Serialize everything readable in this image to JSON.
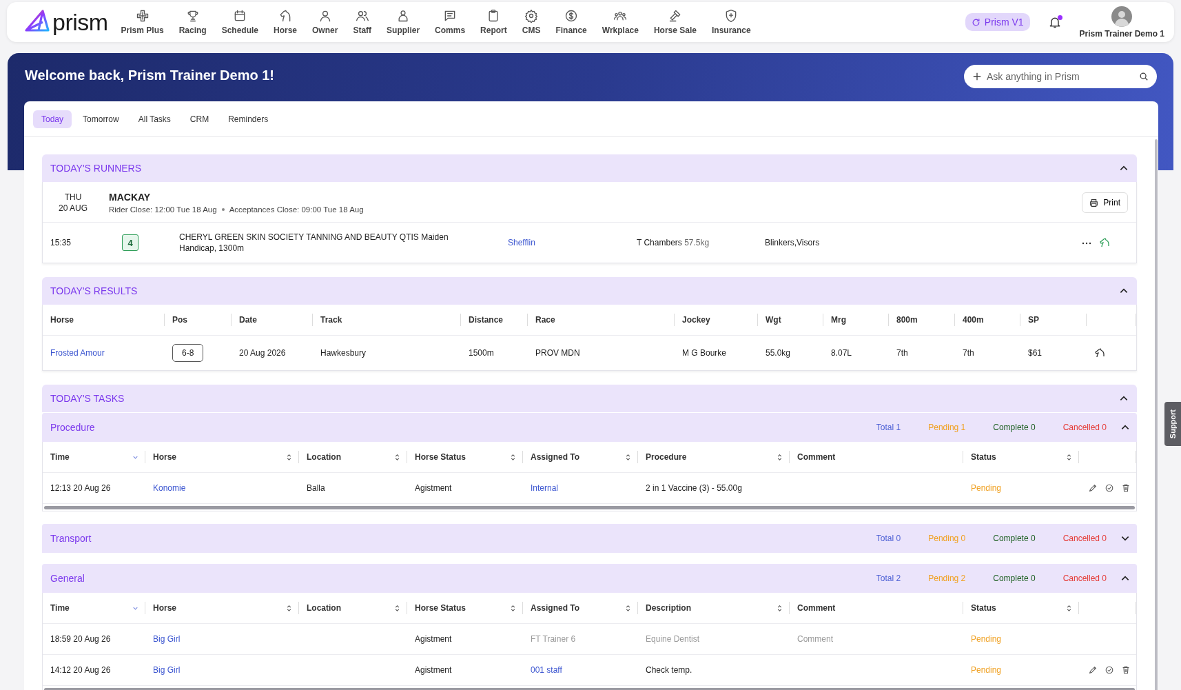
{
  "nav": {
    "logo": "prism",
    "items": [
      {
        "label": "Prism Plus"
      },
      {
        "label": "Racing"
      },
      {
        "label": "Schedule"
      },
      {
        "label": "Horse"
      },
      {
        "label": "Owner"
      },
      {
        "label": "Staff"
      },
      {
        "label": "Supplier"
      },
      {
        "label": "Comms"
      },
      {
        "label": "Report"
      },
      {
        "label": "CMS"
      },
      {
        "label": "Finance"
      },
      {
        "label": "Wrkplace"
      },
      {
        "label": "Horse Sale"
      },
      {
        "label": "Insurance"
      }
    ],
    "version_badge": "Prism V1",
    "notifications": {
      "unread": true
    },
    "user": "Prism Trainer Demo 1"
  },
  "banner": {
    "greeting": "Welcome back, Prism Trainer Demo 1!",
    "ask": {
      "placeholder": "Ask anything in Prism"
    }
  },
  "tabs": [
    {
      "label": "Today",
      "selected": true
    },
    {
      "label": "Tomorrow",
      "selected": false
    },
    {
      "label": "All Tasks",
      "selected": false
    },
    {
      "label": "CRM",
      "selected": false
    },
    {
      "label": "Reminders",
      "selected": false
    }
  ],
  "runners": {
    "title": "TODAY'S RUNNERS",
    "expanded": true,
    "meeting": {
      "day": "THU",
      "date": "20 AUG",
      "venue": "MACKAY",
      "rider_close": "Rider Close: 12:00 Tue 18 Aug",
      "acceptances_close": "Acceptances Close: 09:00 Tue 18 Aug",
      "print": "Print"
    },
    "entries": [
      {
        "time": "15:35",
        "number": "4",
        "race": "CHERYL GREEN SKIN SOCIETY TANNING AND BEAUTY QTIS Maiden Handicap, 1300m",
        "horse": "Shefflin",
        "jockey": "T Chambers",
        "weight": "57.5kg",
        "gear": "Blinkers,Visors"
      }
    ]
  },
  "results": {
    "title": "TODAY'S RESULTS",
    "expanded": true,
    "columns": [
      "Horse",
      "Pos",
      "Date",
      "Track",
      "Distance",
      "Race",
      "Jockey",
      "Wgt",
      "Mrg",
      "800m",
      "400m",
      "SP"
    ],
    "rows": [
      {
        "cells": [
          "Frosted Amour",
          "6-8",
          "20 Aug 2026",
          "Hawkesbury",
          "1500m",
          "PROV MDN",
          "M G Bourke",
          "55.0kg",
          "8.07L",
          "7th",
          "7th",
          "$61"
        ]
      }
    ]
  },
  "tasks": {
    "title": "TODAY'S TASKS",
    "expanded": true,
    "groups": [
      {
        "title": "Procedure",
        "expanded": true,
        "counts": {
          "total": "Total 1",
          "pending": "Pending 1",
          "complete": "Complete 0",
          "cancelled": "Cancelled 0"
        },
        "columns": [
          {
            "label": "Time",
            "sortable": true,
            "sorted": true
          },
          {
            "label": "Horse",
            "sortable": true,
            "sorted": false
          },
          {
            "label": "Location",
            "sortable": true,
            "sorted": false
          },
          {
            "label": "Horse Status",
            "sortable": true,
            "sorted": false
          },
          {
            "label": "Assigned To",
            "sortable": true,
            "sorted": false
          },
          {
            "label": "Procedure",
            "sortable": true,
            "sorted": false
          },
          {
            "label": "Comment",
            "sortable": false,
            "sorted": false
          },
          {
            "label": "Status",
            "sortable": true,
            "sorted": false
          }
        ],
        "rows": [
          {
            "draft": false,
            "time": "12:13 20 Aug 26",
            "horse": "Konomie",
            "location": "Balla",
            "horse_status": "Agistment",
            "assigned_to": "Internal",
            "detail": "2 in 1 Vaccine (3) - 55.00g",
            "status": "Pending"
          }
        ]
      },
      {
        "title": "Transport",
        "expanded": false,
        "counts": {
          "total": "Total 0",
          "pending": "Pending 0",
          "complete": "Complete 0",
          "cancelled": "Cancelled 0"
        }
      },
      {
        "title": "General",
        "expanded": true,
        "counts": {
          "total": "Total 2",
          "pending": "Pending 2",
          "complete": "Complete 0",
          "cancelled": "Cancelled 0"
        },
        "columns": [
          {
            "label": "Time",
            "sortable": true,
            "sorted": true
          },
          {
            "label": "Horse",
            "sortable": true,
            "sorted": false
          },
          {
            "label": "Location",
            "sortable": true,
            "sorted": false
          },
          {
            "label": "Horse Status",
            "sortable": true,
            "sorted": false
          },
          {
            "label": "Assigned To",
            "sortable": true,
            "sorted": false
          },
          {
            "label": "Description",
            "sortable": true,
            "sorted": false
          },
          {
            "label": "Comment",
            "sortable": false,
            "sorted": false
          },
          {
            "label": "Status",
            "sortable": true,
            "sorted": false
          }
        ],
        "rows": [
          {
            "draft": true,
            "time": "18:59 20 Aug 26",
            "horse": "Big Girl",
            "horse_status": "Agistment",
            "assigned_to": "FT Trainer 6",
            "detail": "Equine Dentist",
            "comment": "Comment",
            "status": "Pending"
          },
          {
            "draft": false,
            "time": "14:12 20 Aug 26",
            "horse": "Big Girl",
            "horse_status": "Agistment",
            "assigned_to": "001 staff",
            "detail": "Check temp.",
            "status": "Pending"
          }
        ]
      }
    ]
  },
  "support": "Support"
}
